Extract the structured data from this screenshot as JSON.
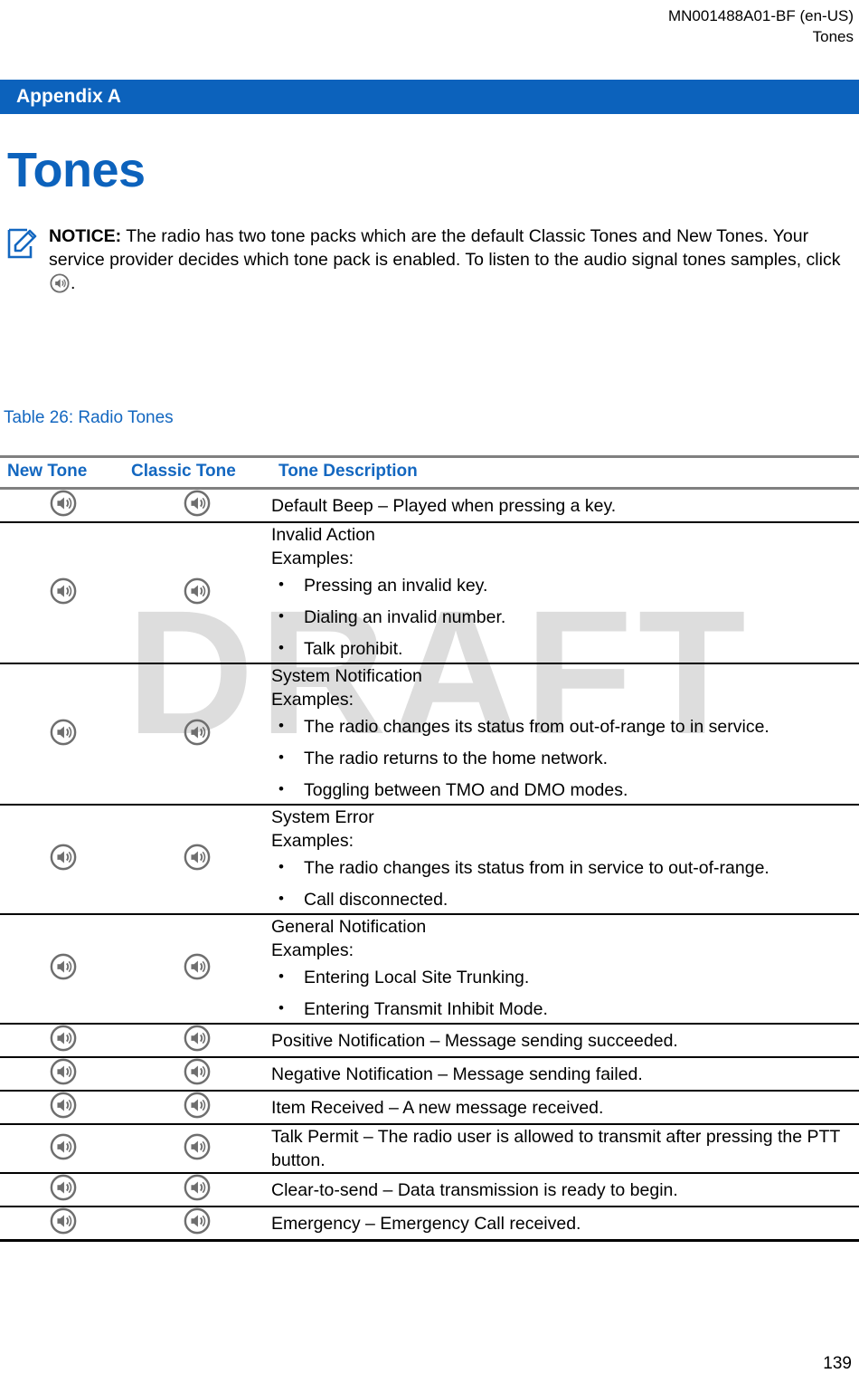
{
  "header": {
    "doc_id": "MN001488A01-BF (en-US)",
    "chapter": "Tones"
  },
  "banner": {
    "label": "Appendix A",
    "color": "#0C62BC"
  },
  "title": {
    "text": "Tones",
    "color": "#0C62BC"
  },
  "notice": {
    "icon": "note-pencil-icon",
    "label": "NOTICE:",
    "text_part1": "The radio has two tone packs which are the default Classic Tones and New Tones. Your service provider decides which tone pack is enabled. To listen to the audio signal tones samples, click",
    "inline_icon": "speaker-icon",
    "text_part2": "."
  },
  "table": {
    "caption": "Table 26: Radio Tones",
    "columns": [
      "New Tone",
      "Classic Tone",
      "Tone Description"
    ],
    "header_color": "#1367C0",
    "rows": [
      {
        "new_tone_icon": "speaker-icon",
        "classic_tone_icon": "speaker-icon",
        "description": "Default Beep – Played when pressing a key.",
        "bullets": []
      },
      {
        "new_tone_icon": "speaker-icon",
        "classic_tone_icon": "speaker-icon",
        "description": "Invalid Action\nExamples:",
        "bullets": [
          "Pressing an invalid key.",
          "Dialing an invalid number.",
          "Talk prohibit."
        ]
      },
      {
        "new_tone_icon": "speaker-icon",
        "classic_tone_icon": "speaker-icon",
        "description": "System Notification\nExamples:",
        "bullets": [
          "The radio changes its status from out-of-range to in service.",
          "The radio returns to the home network.",
          "Toggling between TMO and DMO modes."
        ]
      },
      {
        "new_tone_icon": "speaker-icon",
        "classic_tone_icon": "speaker-icon",
        "description": "System Error\nExamples:",
        "bullets": [
          "The radio changes its status from in service to out-of-range.",
          "Call disconnected."
        ]
      },
      {
        "new_tone_icon": "speaker-icon",
        "classic_tone_icon": "speaker-icon",
        "description": "General Notification\nExamples:",
        "bullets": [
          "Entering Local Site Trunking.",
          "Entering Transmit Inhibit Mode."
        ]
      },
      {
        "new_tone_icon": "speaker-icon",
        "classic_tone_icon": "speaker-icon",
        "description": "Positive Notification – Message sending succeeded.",
        "bullets": []
      },
      {
        "new_tone_icon": "speaker-icon",
        "classic_tone_icon": "speaker-icon",
        "description": "Negative Notification – Message sending failed.",
        "bullets": []
      },
      {
        "new_tone_icon": "speaker-icon",
        "classic_tone_icon": "speaker-icon",
        "description": "Item Received – A new message received.",
        "bullets": []
      },
      {
        "new_tone_icon": "speaker-icon",
        "classic_tone_icon": "speaker-icon",
        "description": "Talk Permit – The radio user is allowed to transmit after pressing the PTT button.",
        "bullets": []
      },
      {
        "new_tone_icon": "speaker-icon",
        "classic_tone_icon": "speaker-icon",
        "description": "Clear-to-send – Data transmission is ready to begin.",
        "bullets": []
      },
      {
        "new_tone_icon": "speaker-icon",
        "classic_tone_icon": "speaker-icon",
        "description": "Emergency – Emergency Call received.",
        "bullets": []
      }
    ]
  },
  "watermark": {
    "text": "DRAFT",
    "color": "#DDDDDD"
  },
  "footer": {
    "page_number": "139"
  }
}
